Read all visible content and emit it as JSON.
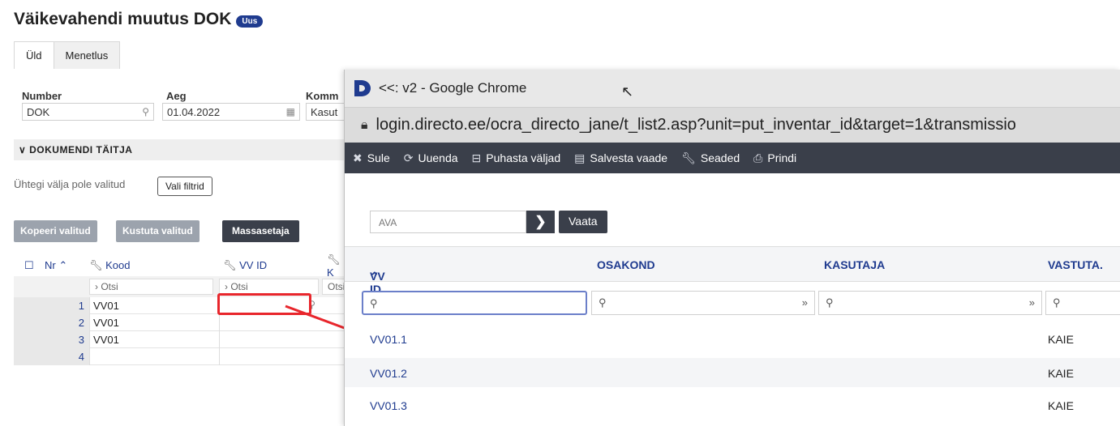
{
  "page": {
    "title": "Väikevahendi muutus DOK",
    "badge": "Uus",
    "tabs": [
      "Üld",
      "Menetlus"
    ]
  },
  "header_fields": {
    "number_label": "Number",
    "number_value": "DOK",
    "aeg_label": "Aeg",
    "aeg_value": "01.04.2022",
    "kommentaar_label": "Komm",
    "kasutaja_value": "Kasut"
  },
  "section": {
    "title": "DOKUMENDI TÄITJA",
    "filter_message": "Ühtegi välja pole valitud",
    "filter_button": "Vali filtrid"
  },
  "actions": {
    "copy": "Kopeeri valitud",
    "delete": "Kustuta valitud",
    "mass": "Massasetaja"
  },
  "grid": {
    "headers": {
      "nr": "Nr",
      "kood": "Kood",
      "vvid": "VV ID",
      "k": "K"
    },
    "search_placeholder": "Otsi",
    "rows": [
      {
        "nr": "1",
        "kood": "VV01"
      },
      {
        "nr": "2",
        "kood": "VV01"
      },
      {
        "nr": "3",
        "kood": "VV01"
      },
      {
        "nr": "4",
        "kood": ""
      }
    ]
  },
  "popup": {
    "window_title": "<<: v2 - Google Chrome",
    "address": "login.directo.ee/ocra_directo_jane/t_list2.asp?unit=put_inventar_id&target=1&transmissio",
    "toolbar": [
      "Sule",
      "Uuenda",
      "Puhasta väljad",
      "Salvesta vaade",
      "Seaded",
      "Prindi"
    ],
    "search_value": "AVA",
    "view_button": "Vaata",
    "columns": [
      "VV ID",
      "OSAKOND",
      "KASUTAJA",
      "VASTUTA."
    ],
    "rows": [
      {
        "id": "VV01.1",
        "vastutaja": "KAIE"
      },
      {
        "id": "VV01.2",
        "vastutaja": "KAIE"
      },
      {
        "id": "VV01.3",
        "vastutaja": "KAIE"
      }
    ]
  },
  "colors": {
    "accent": "#1f3b8f",
    "toolbar": "#3a3f4a",
    "highlight": "#e8262c"
  }
}
